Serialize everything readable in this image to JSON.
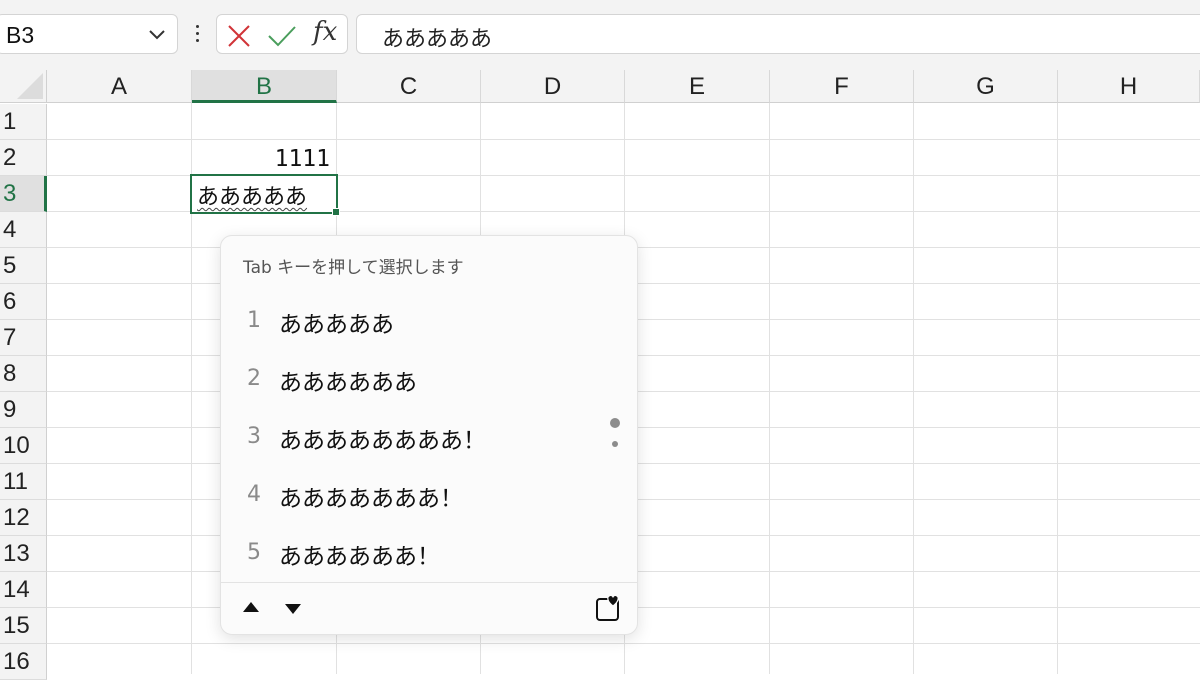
{
  "formula_bar": {
    "name_box": "B3",
    "formula": "あああああ",
    "fx_label": "fx"
  },
  "columns": [
    "A",
    "B",
    "C",
    "D",
    "E",
    "F",
    "G",
    "H"
  ],
  "rows": [
    "1",
    "2",
    "3",
    "4",
    "5",
    "6",
    "7",
    "8",
    "9",
    "10",
    "11",
    "12",
    "13",
    "14",
    "15",
    "16"
  ],
  "selected": {
    "column": "B",
    "row": "3"
  },
  "cells": {
    "B2": "1111",
    "B3": "あああああ"
  },
  "autocomplete": {
    "hint": "Tab キーを押して選択します",
    "suggestions": [
      {
        "num": "1",
        "text": "あああああ"
      },
      {
        "num": "2",
        "text": "ああああああ"
      },
      {
        "num": "3",
        "text": "ああああああああ！"
      },
      {
        "num": "4",
        "text": "あああああああ！"
      },
      {
        "num": "5",
        "text": "ああああああ！"
      }
    ]
  },
  "colors": {
    "accent": "#217346",
    "cancel": "#d13438",
    "confirm": "#4a9e5c"
  },
  "icons": [
    "chevron-down-icon",
    "more-vertical-icon",
    "cancel-icon",
    "confirm-icon",
    "function-icon",
    "arrow-up-icon",
    "arrow-down-icon",
    "favorite-icon"
  ]
}
